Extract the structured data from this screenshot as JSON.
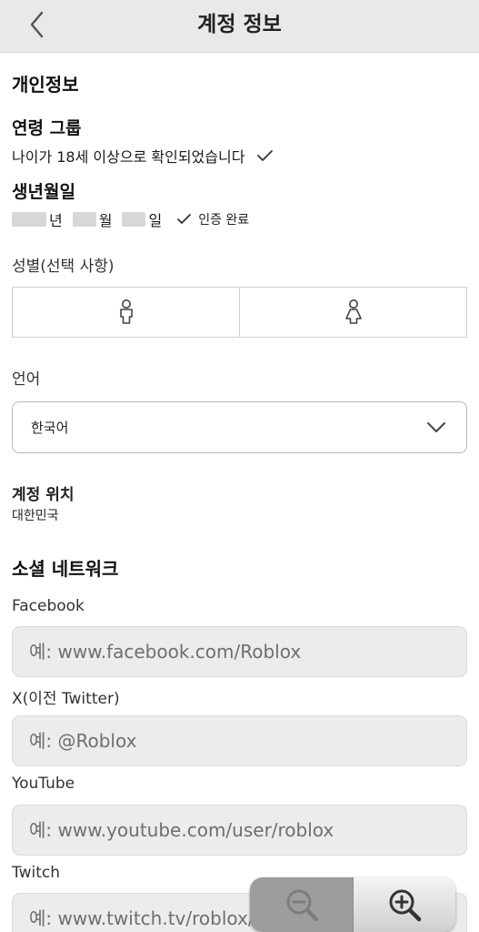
{
  "header": {
    "title": "계정 정보",
    "back_icon": "chevron-left-icon"
  },
  "personal": {
    "section_title": "개인정보",
    "age_group": {
      "label": "연령 그룹",
      "value": "나이가 18세 이상으로 확인되었습니다"
    },
    "birthdate": {
      "label": "생년월일",
      "year_unit": "년",
      "month_unit": "월",
      "day_unit": "일",
      "verified_text": "인증 완료"
    },
    "gender": {
      "label": "성별(선택 사항)",
      "options": [
        "male-icon",
        "female-icon"
      ]
    },
    "language": {
      "label": "언어",
      "selected": "한국어"
    },
    "location": {
      "label": "계정 위치",
      "value": "대한민국"
    }
  },
  "social": {
    "section_title": "소셜 네트워크",
    "fields": [
      {
        "label": "Facebook",
        "placeholder": "예: www.facebook.com/Roblox"
      },
      {
        "label": "X(이전 Twitter)",
        "placeholder": "예: @Roblox"
      },
      {
        "label": "YouTube",
        "placeholder": "예: www.youtube.com/user/roblox"
      },
      {
        "label": "Twitch",
        "placeholder": "예: www.twitch.tv/roblox/profile"
      }
    ]
  },
  "zoom": {
    "out_icon": "zoom-out-icon",
    "in_icon": "zoom-in-icon"
  },
  "colors": {
    "header_bg": "#e9e9ea",
    "input_bg": "#ececed",
    "border": "#cfcfd2"
  }
}
